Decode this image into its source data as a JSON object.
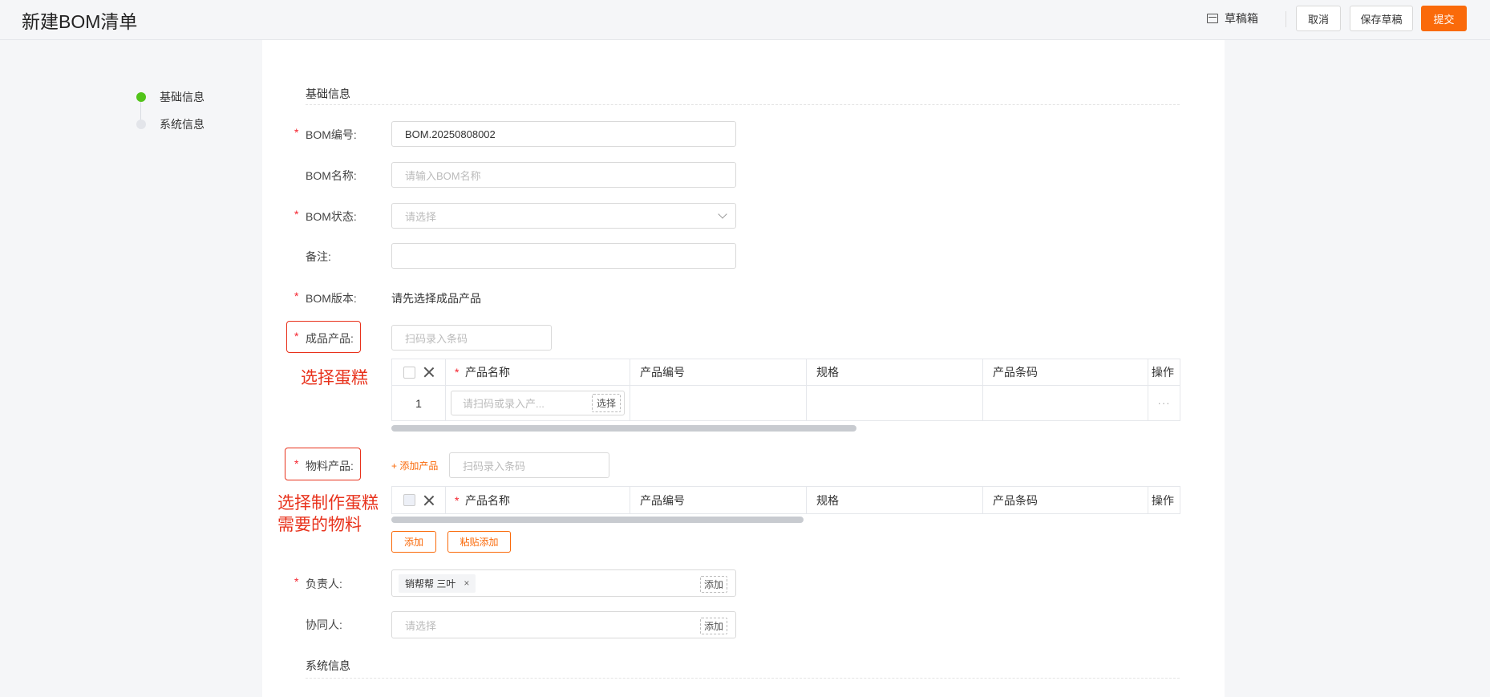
{
  "header": {
    "title": "新建BOM清单",
    "drafts_label": "草稿箱",
    "cancel_label": "取消",
    "save_draft_label": "保存草稿",
    "submit_label": "提交",
    "accent_color": "#fa6a0a"
  },
  "steps": [
    {
      "label": "基础信息",
      "status": "active"
    },
    {
      "label": "系统信息",
      "status": "idle"
    }
  ],
  "form": {
    "section_basic": "基础信息",
    "section_system": "系统信息",
    "required_mark": "*",
    "bom_code": {
      "label": "BOM编号:",
      "value": "BOM.20250808002"
    },
    "bom_name": {
      "label": "BOM名称:",
      "placeholder": "请输入BOM名称"
    },
    "bom_status": {
      "label": "BOM状态:",
      "placeholder": "请选择"
    },
    "remark": {
      "label": "备注:",
      "value": ""
    },
    "bom_version": {
      "label": "BOM版本:",
      "value": "请先选择成品产品"
    },
    "finished_product": {
      "label": "成品产品:",
      "placeholder": "扫码录入条码",
      "columns": [
        "产品名称",
        "产品编号",
        "规格",
        "产品条码",
        "操作"
      ],
      "rows": [
        {
          "index": "1",
          "name_placeholder": "请扫码或录入产...",
          "select_label": "选择",
          "more": "···"
        }
      ]
    },
    "material_product": {
      "label": "物料产品:",
      "add_link": "+ 添加产品",
      "placeholder": "扫码录入条码",
      "columns": [
        "产品名称",
        "产品编号",
        "规格",
        "产品条码",
        "操作"
      ],
      "add_button": "添加",
      "paste_add_button": "粘贴添加"
    },
    "owner": {
      "label": "负责人:",
      "tag": "销帮帮 三叶",
      "tag_close": "×",
      "add_label": "添加"
    },
    "collaborator": {
      "label": "协同人:",
      "placeholder": "请选择",
      "add_label": "添加"
    }
  },
  "annotations": {
    "finished": "选择蛋糕",
    "material_line1": "选择制作蛋糕",
    "material_line2": "需要的物料",
    "color": "#e8321c"
  }
}
